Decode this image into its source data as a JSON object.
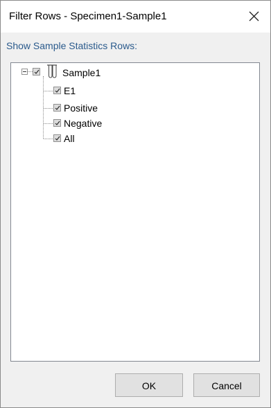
{
  "window": {
    "title": "Filter Rows - Specimen1-Sample1",
    "close_icon": "close-icon"
  },
  "section": {
    "label": "Show Sample Statistics Rows:"
  },
  "tree": {
    "root": {
      "label": "Sample1",
      "checked": true,
      "expanded": true,
      "icon": "test-tube-icon"
    },
    "children": [
      {
        "label": "E1",
        "checked": true
      },
      {
        "label": "Positive",
        "checked": true
      },
      {
        "label": "Negative",
        "checked": true
      },
      {
        "label": "All",
        "checked": true
      }
    ]
  },
  "buttons": {
    "ok": "OK",
    "cancel": "Cancel"
  },
  "colors": {
    "label_accent": "#2a5a8c",
    "window_background": "#f0f0f0",
    "button_face": "#e1e1e1"
  }
}
